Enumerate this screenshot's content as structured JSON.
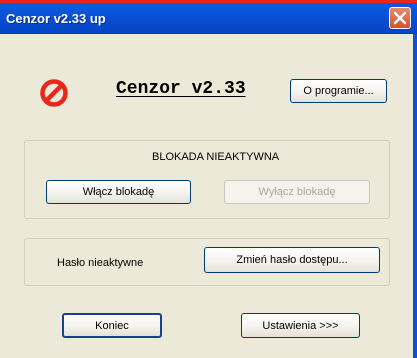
{
  "window": {
    "title": "Cenzor v2.33 up",
    "close_icon": "close-icon"
  },
  "header": {
    "app_name": "Cenzor v2.33",
    "icon": "prohibited-icon",
    "about_label": "O programie..."
  },
  "block_group": {
    "status": "BLOKADA NIEAKTYWNA",
    "enable_label": "Włącz blokadę",
    "disable_label": "Wyłącz blokadę"
  },
  "password_group": {
    "status": "Hasło nieaktywne",
    "change_label": "Zmień hasło dostępu..."
  },
  "footer": {
    "exit_label": "Koniec",
    "settings_label": "Ustawienia >>>"
  },
  "colors": {
    "title_bar": "#0a4fd6",
    "window_bg": "#ece9d8",
    "icon_red": "#e8271a"
  }
}
